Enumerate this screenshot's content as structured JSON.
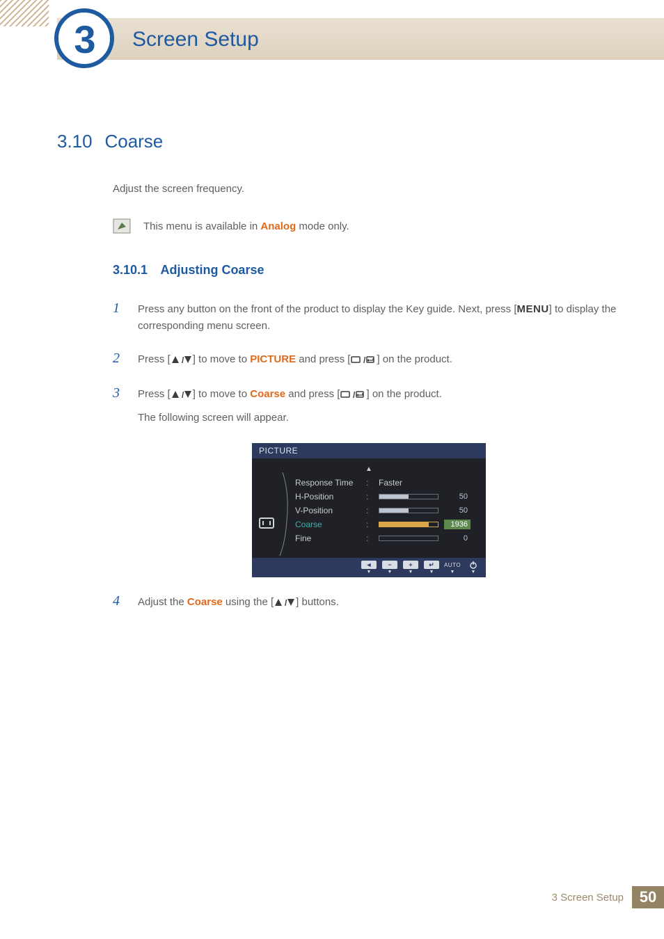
{
  "chapter": {
    "number": "3",
    "title": "Screen Setup"
  },
  "section": {
    "number": "3.10",
    "title": "Coarse",
    "intro": "Adjust the screen frequency."
  },
  "note": {
    "prefix": "This menu is available in ",
    "mode": "Analog",
    "suffix": " mode only."
  },
  "subsection": {
    "number": "3.10.1",
    "title": "Adjusting Coarse"
  },
  "steps": {
    "s1": {
      "num": "1",
      "a": "Press any button on the front of the product to display the Key guide. Next, press [",
      "menu": "MENU",
      "b": "] to display the corresponding menu screen."
    },
    "s2": {
      "num": "2",
      "a": "Press [",
      "b": "] to move to ",
      "target": "PICTURE",
      "c": " and press [",
      "d": "] on the product."
    },
    "s3": {
      "num": "3",
      "a": "Press [",
      "b": "] to move to ",
      "target": "Coarse",
      "c": " and press [",
      "d": "] on the product.",
      "follow": "The following screen will appear."
    },
    "s4": {
      "num": "4",
      "a": "Adjust the ",
      "target": "Coarse",
      "b": " using the [",
      "c": "] buttons."
    }
  },
  "osd": {
    "title": "PICTURE",
    "rows": [
      {
        "label": "Response Time",
        "value_text": "Faster",
        "selected": false
      },
      {
        "label": "H-Position",
        "value_num": "50",
        "fill": 50,
        "selected": false
      },
      {
        "label": "V-Position",
        "value_num": "50",
        "fill": 50,
        "selected": false
      },
      {
        "label": "Coarse",
        "value_num": "1936",
        "fill": 85,
        "selected": true
      },
      {
        "label": "Fine",
        "value_num": "0",
        "fill": 0,
        "selected": false
      }
    ],
    "footer_auto": "AUTO"
  },
  "footer": {
    "label": "3 Screen Setup",
    "page": "50"
  }
}
